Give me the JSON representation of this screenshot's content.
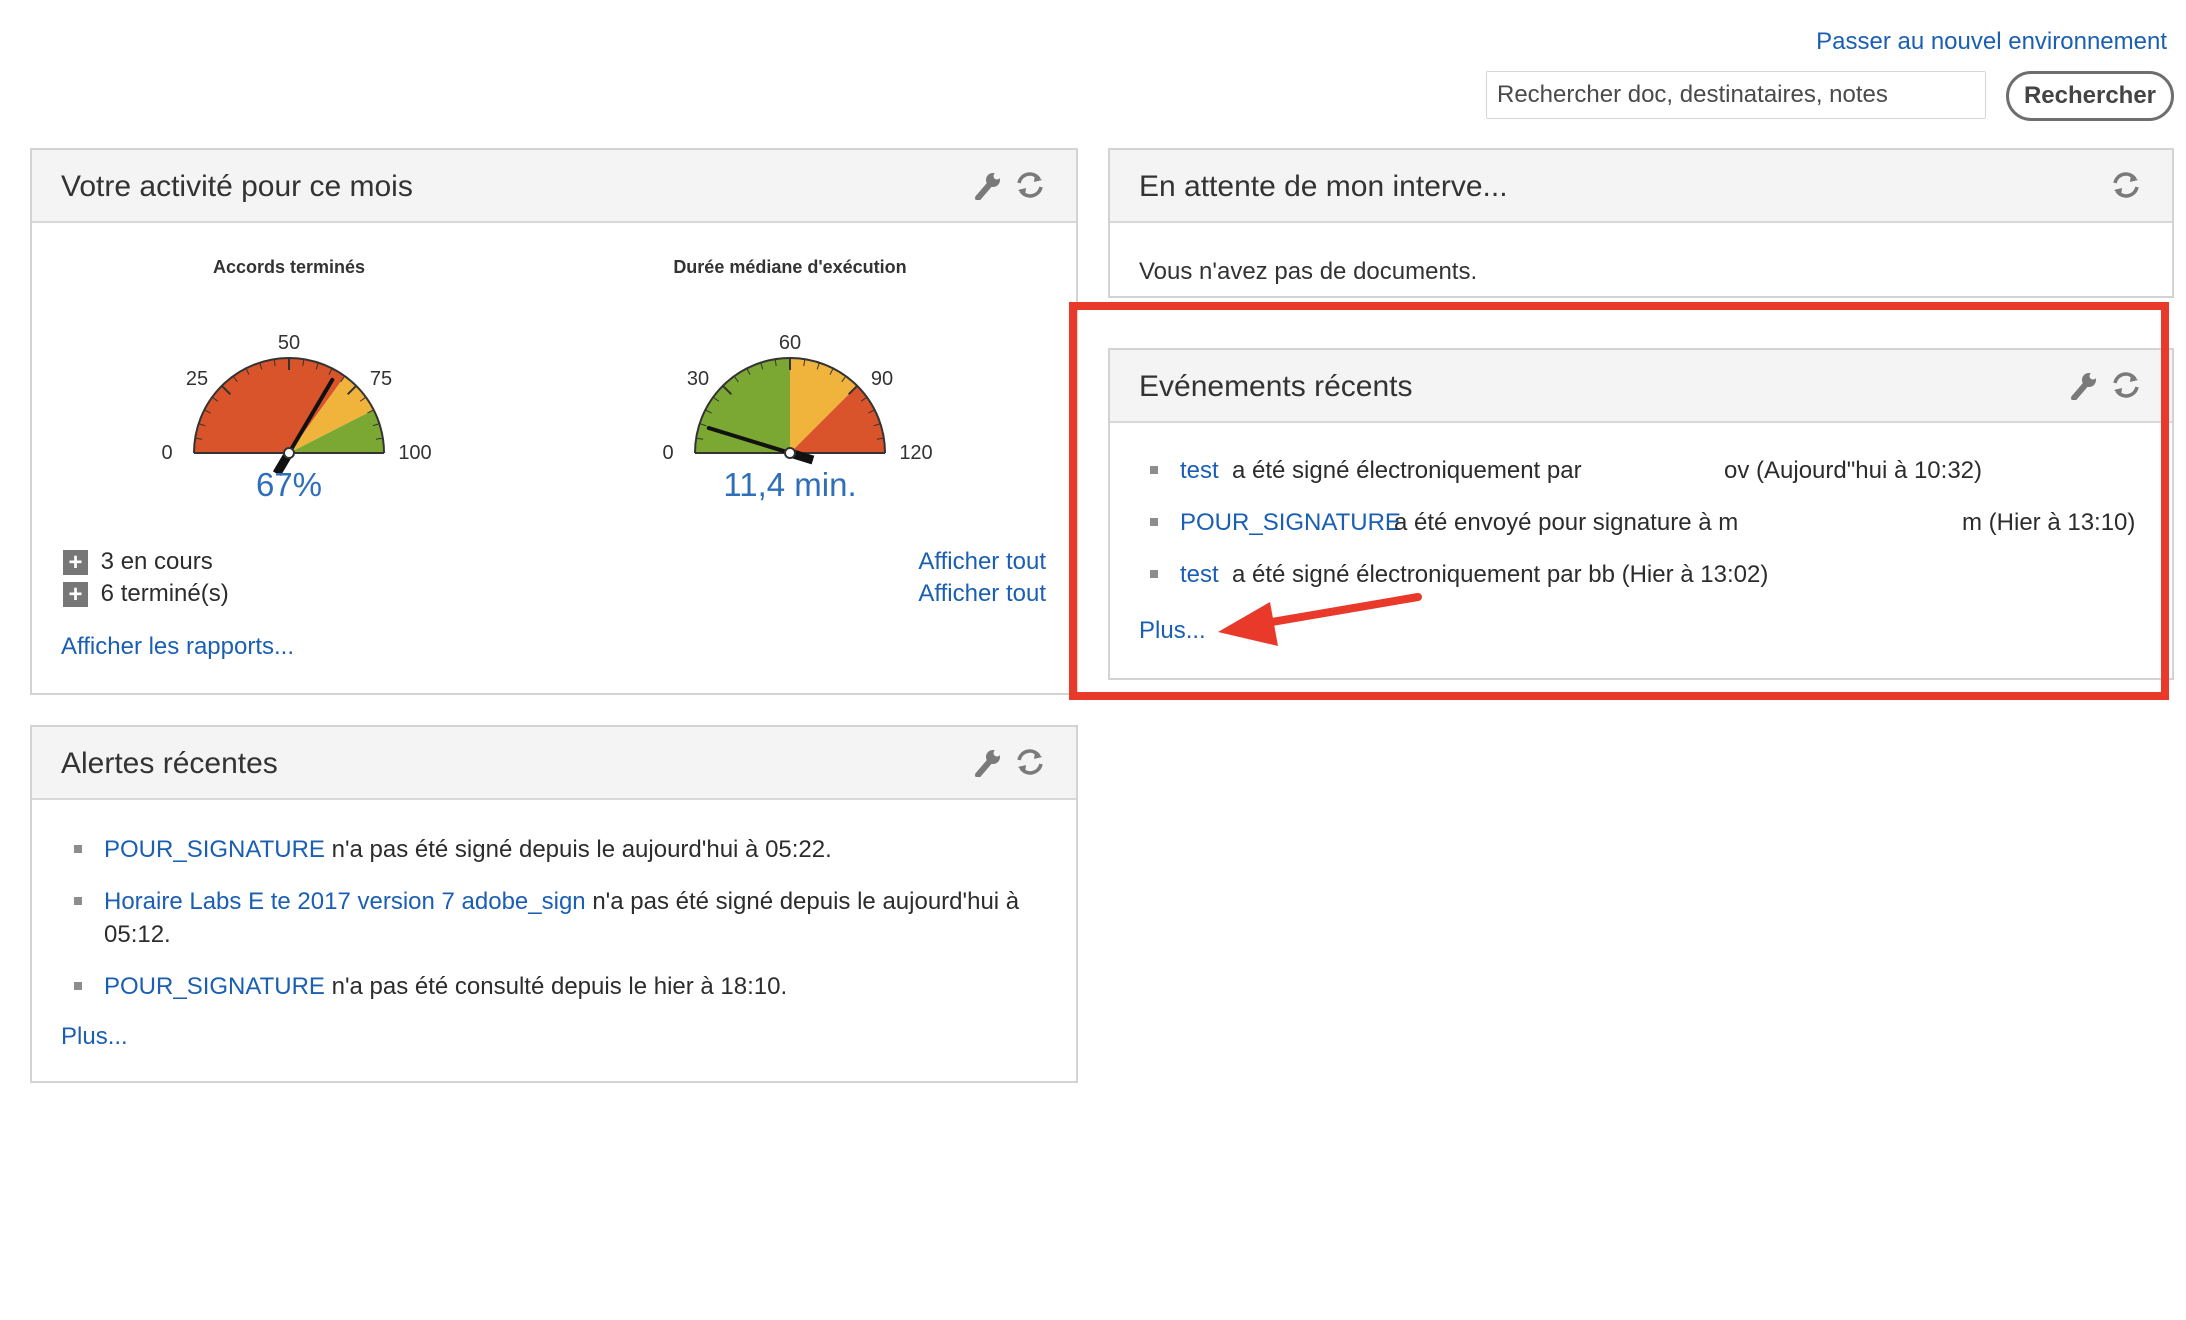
{
  "top": {
    "switch_link": "Passer au nouvel environnement",
    "search_placeholder": "Rechercher doc, destinataires, notes",
    "search_button": "Rechercher"
  },
  "activity": {
    "title": "Votre activité pour ce mois",
    "gauge1": {
      "title": "Accords terminés",
      "labels": [
        "0",
        "25",
        "50",
        "75",
        "100"
      ],
      "value_text": "67%",
      "value": 67,
      "max": 100
    },
    "gauge2": {
      "title": "Durée médiane d'exécution",
      "labels": [
        "0",
        "30",
        "60",
        "90",
        "120"
      ],
      "value_text": "11,4 min.",
      "value": 11.4,
      "max": 120
    },
    "in_progress": "3 en cours",
    "completed": "6 terminé(s)",
    "view_all_1": "Afficher tout",
    "view_all_2": "Afficher tout",
    "reports_link": "Afficher les rapports..."
  },
  "waiting": {
    "title": "En attente de mon interve...",
    "empty_text": "Vous n'avez pas de documents."
  },
  "events": {
    "title": "Evénements récents",
    "items": [
      {
        "link": "test",
        "text": "a été signé électroniquement par",
        "tail": "ov (Aujourd\"hui à 10:32)"
      },
      {
        "link": "POUR_SIGNATURE",
        "text": "a été envoyé pour signature à m",
        "tail": "m (Hier à 13:10)"
      },
      {
        "link": "test",
        "text": "a été signé électroniquement par bb (Hier à 13:02)",
        "tail": ""
      }
    ],
    "more": "Plus..."
  },
  "alerts": {
    "title": "Alertes récentes",
    "items": [
      {
        "link": "POUR_SIGNATURE",
        "text": " n'a pas été signé depuis le aujourd'hui à 05:22."
      },
      {
        "link": "Horaire Labs E te 2017 version 7 adobe_sign",
        "text": " n'a pas été signé depuis le aujourd'hui à",
        "line2": "05:12."
      },
      {
        "link": "POUR_SIGNATURE",
        "text": " n'a pas été consulté depuis le hier à 18:10."
      }
    ],
    "more": "Plus..."
  },
  "colors": {
    "link": "#1a5fb4",
    "gauge_red": "#d9542a",
    "gauge_yellow": "#f0b43c",
    "gauge_green": "#7aa832",
    "highlight": "#e8392b"
  }
}
